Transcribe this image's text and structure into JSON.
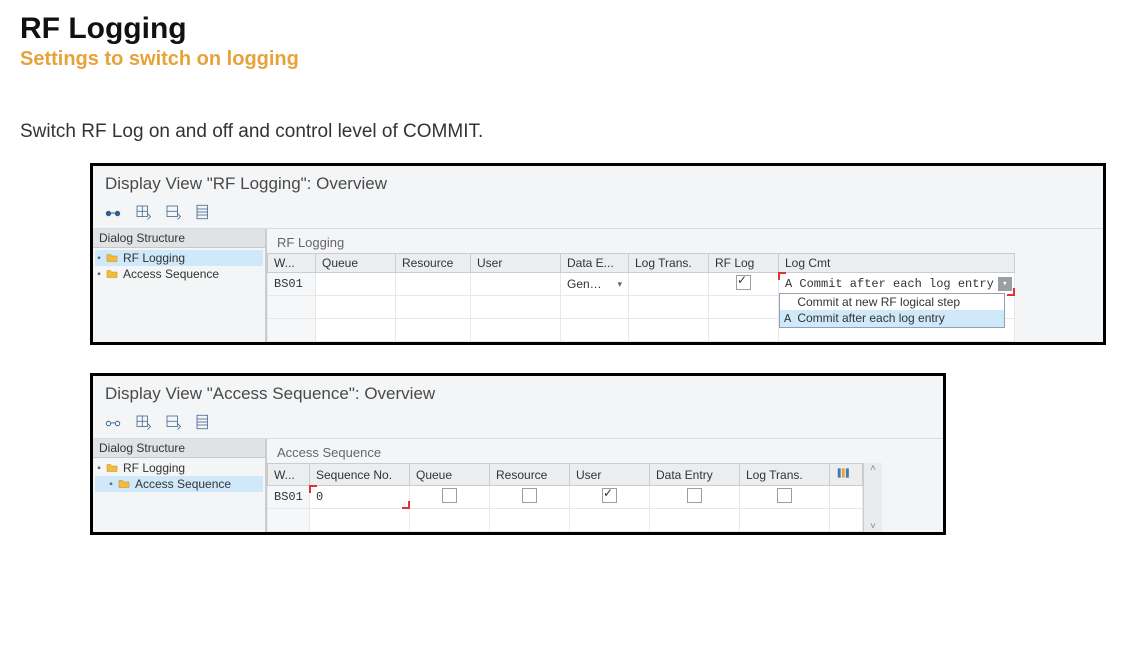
{
  "page": {
    "title": "RF Logging",
    "subtitle": "Settings to switch on logging",
    "description": "Switch RF Log on and off and control level of COMMIT."
  },
  "panel1": {
    "window_title": "Display View \"RF Logging\": Overview",
    "tree_header": "Dialog Structure",
    "tree": [
      {
        "label": "RF Logging",
        "selected": true,
        "indent": 0
      },
      {
        "label": "Access Sequence",
        "selected": false,
        "indent": 0
      }
    ],
    "grid_title": "RF Logging",
    "columns": [
      "W...",
      "Queue",
      "Resource",
      "User",
      "Data E...",
      "Log Trans.",
      "RF Log",
      "Log Cmt"
    ],
    "row": {
      "warehouse": "BS01",
      "queue": "",
      "resource": "",
      "user": "",
      "data_entry_display": "Gen…",
      "log_trans": "",
      "rf_log_checked": true,
      "log_cmt_selected": "A Commit after each log entry",
      "log_cmt_options": [
        {
          "code": "",
          "text": "Commit at new RF logical step"
        },
        {
          "code": "A",
          "text": "Commit after each log entry"
        }
      ]
    }
  },
  "panel2": {
    "window_title": "Display View \"Access Sequence\": Overview",
    "tree_header": "Dialog Structure",
    "tree": [
      {
        "label": "RF Logging",
        "selected": false,
        "indent": 0
      },
      {
        "label": "Access Sequence",
        "selected": true,
        "indent": 1
      }
    ],
    "grid_title": "Access Sequence",
    "columns": [
      "W...",
      "Sequence No.",
      "Queue",
      "Resource",
      "User",
      "Data Entry",
      "Log Trans."
    ],
    "row": {
      "warehouse": "BS01",
      "sequence_no": "0",
      "queue_checked": false,
      "resource_checked": false,
      "user_checked": true,
      "data_entry_checked": false,
      "log_trans_checked": false
    }
  },
  "icons": {
    "toolbar": [
      "glasses-icon",
      "expand-all-icon",
      "collapse-all-icon",
      "position-icon"
    ]
  }
}
